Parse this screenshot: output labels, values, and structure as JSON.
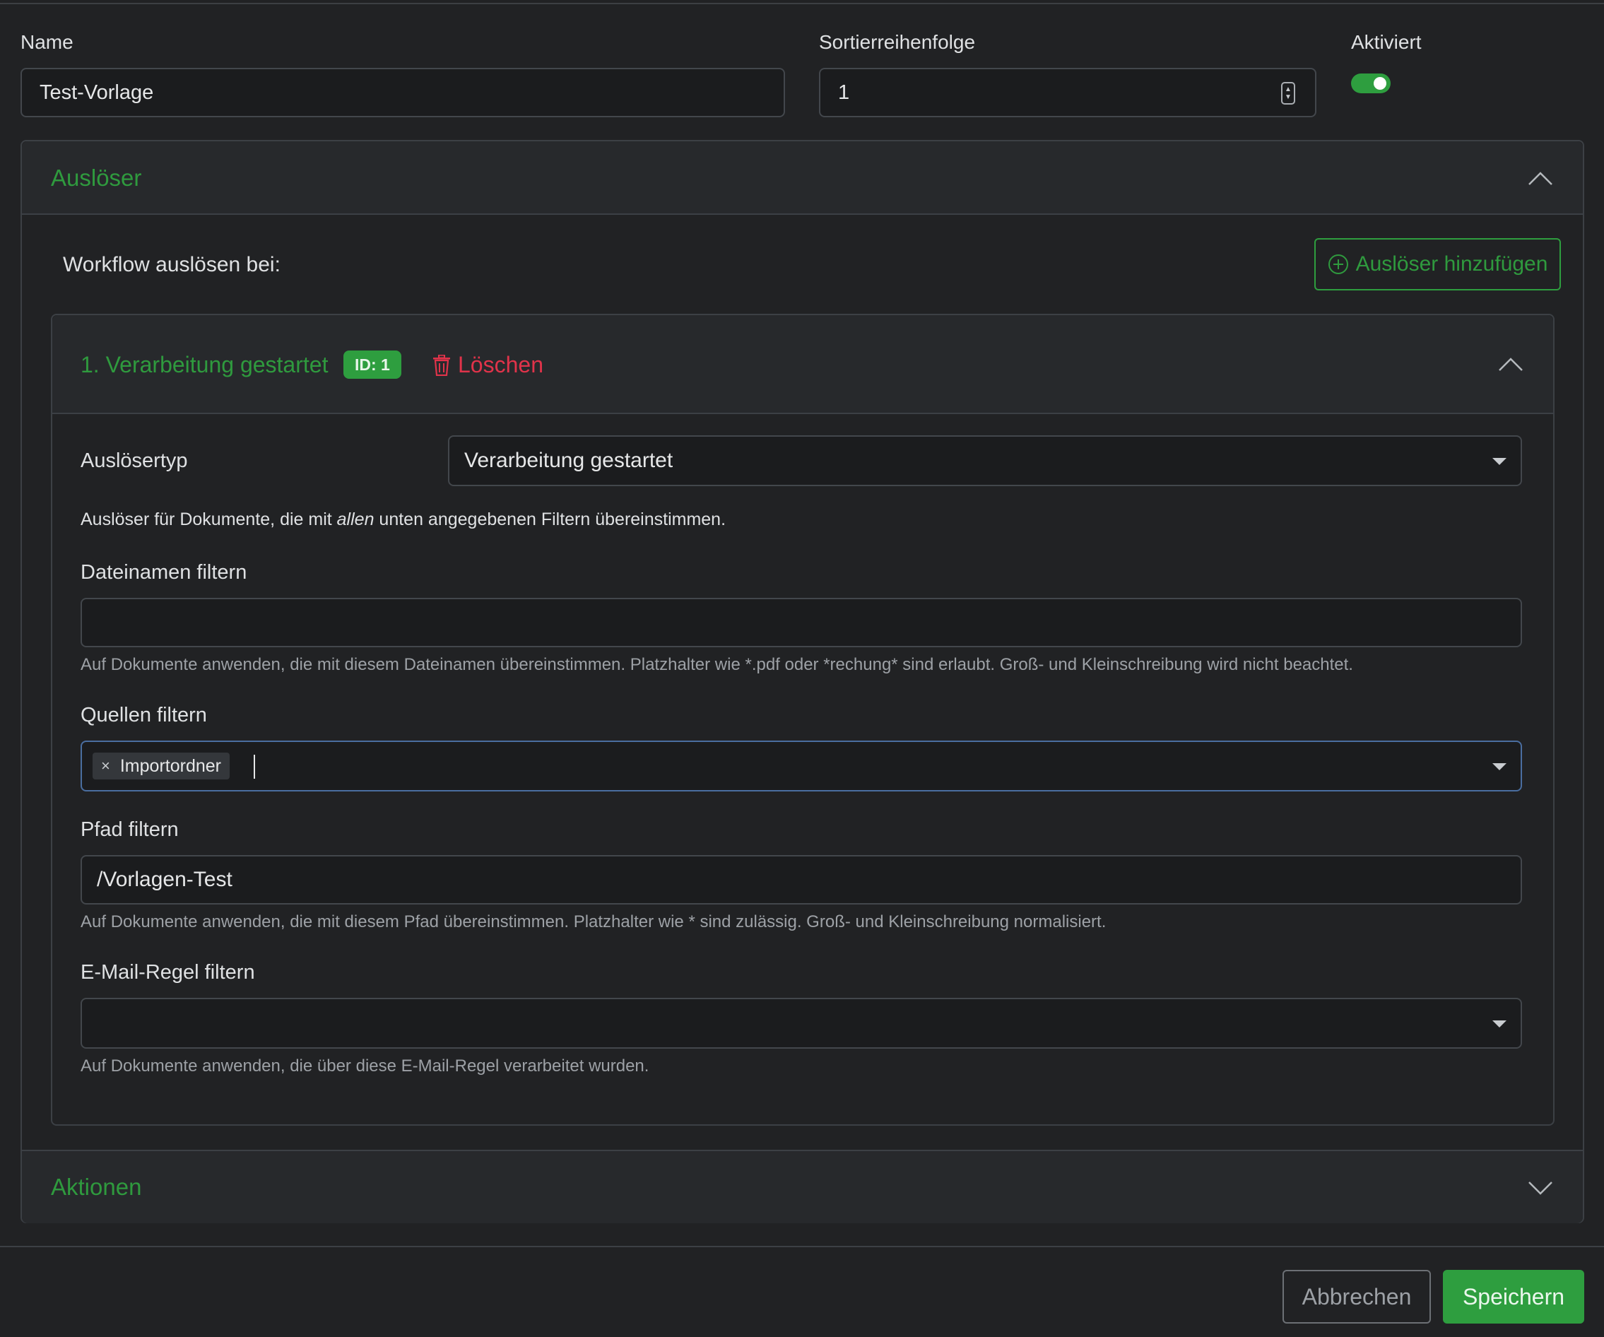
{
  "form": {
    "name_label": "Name",
    "name_value": "Test-Vorlage",
    "sort_label": "Sortierreihenfolge",
    "sort_value": "1",
    "enabled_label": "Aktiviert",
    "enabled": true
  },
  "triggers_section": {
    "title": "Auslöser",
    "workflow_label": "Workflow auslösen bei:",
    "add_button": "Auslöser hinzufügen"
  },
  "trigger": {
    "title": "1. Verarbeitung gestartet",
    "id_badge": "ID: 1",
    "delete_label": "Löschen",
    "type_label": "Auslösertyp",
    "type_value": "Verarbeitung gestartet",
    "description_before": "Auslöser für Dokumente, die mit ",
    "description_emphasis": "allen",
    "description_after": " unten angegebenen Filtern übereinstimmen.",
    "filename_label": "Dateinamen filtern",
    "filename_value": "",
    "filename_help": "Auf Dokumente anwenden, die mit diesem Dateinamen übereinstimmen. Platzhalter wie *.pdf oder *rechung* sind erlaubt. Groß- und Kleinschreibung wird nicht beachtet.",
    "sources_label": "Quellen filtern",
    "sources_tags": [
      "Importordner"
    ],
    "path_label": "Pfad filtern",
    "path_value": "/Vorlagen-Test",
    "path_help": "Auf Dokumente anwenden, die mit diesem Pfad übereinstimmen. Platzhalter wie * sind zulässig. Groß- und Kleinschreibung normalisiert.",
    "mailrule_label": "E-Mail-Regel filtern",
    "mailrule_value": "",
    "mailrule_help": "Auf Dokumente anwenden, die über diese E-Mail-Regel verarbeitet wurden."
  },
  "actions_section": {
    "title": "Aktionen"
  },
  "footer": {
    "cancel_label": "Abbrechen",
    "save_label": "Speichern"
  },
  "colors": {
    "accent": "#2e9e3f",
    "danger": "#e0334a",
    "background": "#212224"
  }
}
